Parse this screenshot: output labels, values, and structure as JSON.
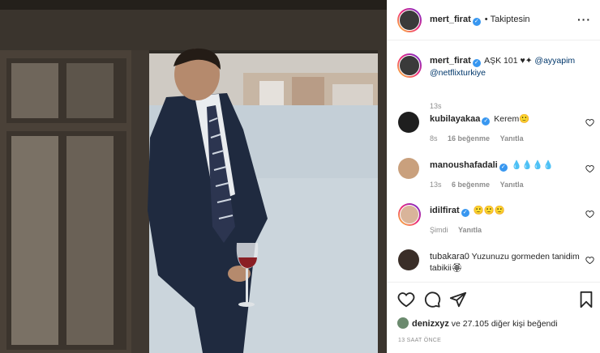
{
  "post": {
    "image_alt": "Man in dark suit with striped tie holding a glass of red wine, leaning in a window frame overlooking water",
    "owner": {
      "username": "mert_firat",
      "verified": true
    },
    "follow_status": "Takiptesin",
    "caption": {
      "username": "mert_firat",
      "text_prefix": "AŞK 101 ♥✦",
      "mention1": "@ayyapim",
      "mention2": "@netflixturkiye",
      "time": "13s"
    },
    "comments": [
      {
        "username": "kubilayakaa",
        "verified": true,
        "text": "Kerem🙂",
        "time": "8s",
        "likes": "16 beğenme",
        "reply": "Yanıtla"
      },
      {
        "username": "manoushafadali",
        "verified": true,
        "text": "💧💧💧💧",
        "time": "13s",
        "likes": "6 beğenme",
        "reply": "Yanıtla"
      },
      {
        "username": "idilfirat",
        "verified": true,
        "text": "🙂🙂🙂",
        "time": "Şimdi",
        "likes": "",
        "reply": "Yanıtla"
      },
      {
        "username": "tubakara0",
        "verified": false,
        "text": "Yuzunuzu gormeden tanidim tabikii🏵",
        "time": "",
        "likes": "",
        "reply": ""
      }
    ],
    "likes_line": {
      "user": "denizxyz",
      "rest": "ve 27.105 diğer kişi beğendi"
    },
    "time_ago": "13 SAAT ÖNCE"
  },
  "icons": {
    "more": "more-dots-icon",
    "heart": "heart-icon",
    "comment": "comment-icon",
    "share": "share-icon",
    "save": "bookmark-icon"
  },
  "colors": {
    "verified": "#3897f0",
    "link": "#00376b",
    "muted": "#8e8e8e",
    "border": "#efefef"
  }
}
